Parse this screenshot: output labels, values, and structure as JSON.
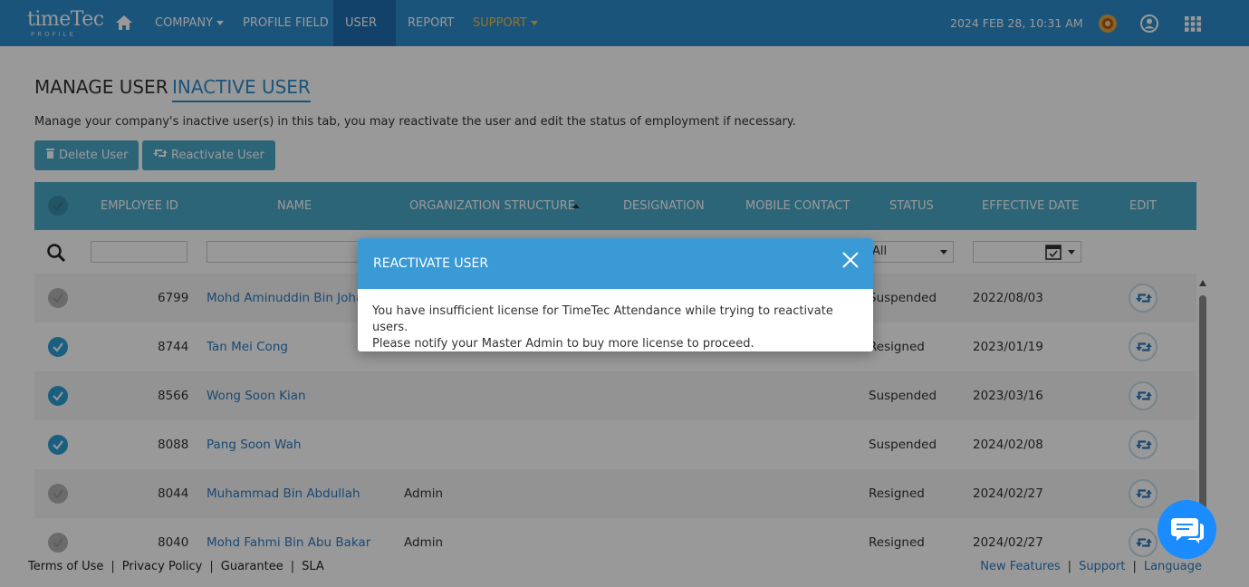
{
  "app": {
    "logo_text": "timeTec",
    "logo_sub": "PROFILE",
    "nav": [
      "COMPANY",
      "PROFILE FIELD",
      "USER",
      "REPORT",
      "SUPPORT"
    ],
    "datetime": "2024 FEB 28, 10:31 AM"
  },
  "page": {
    "tab_manage": "MANAGE USER",
    "tab_inactive": "INACTIVE USER",
    "description": "Manage your company's inactive user(s) in this tab, you may reactivate the user and edit the status of employment if necessary.",
    "delete_button": "Delete User",
    "reactivate_button": "Reactivate User"
  },
  "table": {
    "headers": [
      "EMPLOYEE ID",
      "NAME",
      "ORGANIZATION STRUCTURE",
      "DESIGNATION",
      "MOBILE CONTACT",
      "STATUS",
      "EFFECTIVE DATE",
      "EDIT"
    ],
    "status_filter": "All",
    "rows": [
      {
        "id": "6799",
        "name": "Mohd Aminuddin Bin Johari",
        "org": "",
        "status": "Suspended",
        "date": "2022/08/03",
        "checked": false
      },
      {
        "id": "8744",
        "name": "Tan Mei Cong",
        "org": "",
        "status": "Resigned",
        "date": "2023/01/19",
        "checked": true
      },
      {
        "id": "8566",
        "name": "Wong Soon Kian",
        "org": "",
        "status": "Suspended",
        "date": "2023/03/16",
        "checked": true
      },
      {
        "id": "8088",
        "name": "Pang Soon Wah",
        "org": "",
        "status": "Suspended",
        "date": "2024/02/08",
        "checked": true
      },
      {
        "id": "8044",
        "name": "Muhammad Bin Abdullah",
        "org": "Admin",
        "status": "Resigned",
        "date": "2024/02/27",
        "checked": false
      },
      {
        "id": "8040",
        "name": "Mohd Fahmi Bin Abu Bakar",
        "org": "Admin",
        "status": "Resigned",
        "date": "2024/02/27",
        "checked": false
      }
    ]
  },
  "footer": {
    "left": [
      "Terms of Use",
      "Privacy Policy",
      "Guarantee",
      "SLA"
    ],
    "right": [
      "New Features",
      "Support",
      "Language"
    ]
  },
  "modal": {
    "title": "REACTIVATE USER",
    "line1": "You have insufficient license for TimeTec Attendance while trying to reactivate users.",
    "line2": "Please notify your Master Admin to buy more license to proceed."
  },
  "colors": {
    "nav": "#2d8ccd",
    "table_header": "#4aa9c8",
    "modal_header": "#3a9ad6",
    "link": "#2d7ac0"
  }
}
